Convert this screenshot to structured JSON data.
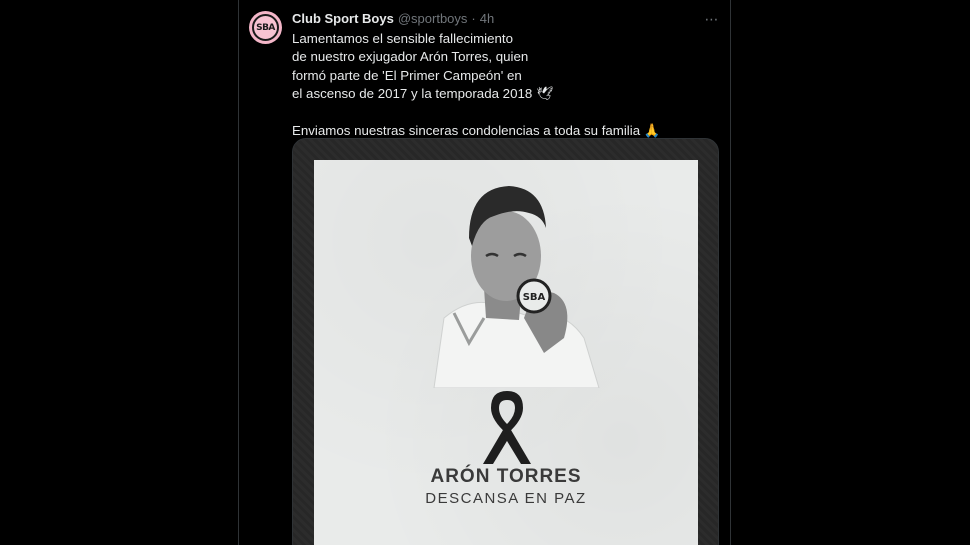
{
  "tweet": {
    "display_name": "Club Sport Boys",
    "handle": "@sportboys",
    "separator": "·",
    "time": "4h",
    "more_icon": "⋯",
    "avatar_text": "SBA",
    "lines": [
      "Lamentamos el sensible fallecimiento",
      "de nuestro exjugador Arón Torres, quien",
      "formó parte de 'El Primer Campeón' en",
      "el ascenso de 2017 y la temporada 2018 🕊"
    ],
    "second_paragraph": "Enviamos nuestras sinceras condolencias a toda su familia 🙏"
  },
  "media": {
    "name": "ARÓN TORRES",
    "subtitle": "DESCANSA EN PAZ",
    "badge_text": "SBA",
    "colors": {
      "poster_bg": "#e9ebea",
      "avatar_bg": "#f4b6c8",
      "ribbon": "#1e1e1e"
    }
  }
}
